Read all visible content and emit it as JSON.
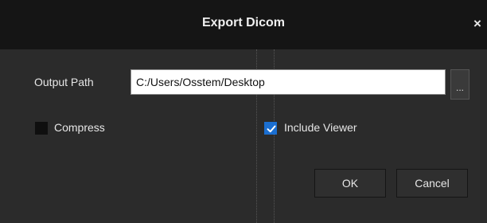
{
  "dialog": {
    "title": "Export Dicom",
    "close_label": "×"
  },
  "output": {
    "label": "Output Path",
    "value": "C:/Users/Osstem/Desktop",
    "browse_label": "..."
  },
  "options": {
    "compress_label": "Compress",
    "compress_checked": false,
    "include_viewer_label": "Include Viewer",
    "include_viewer_checked": true
  },
  "buttons": {
    "ok_label": "OK",
    "cancel_label": "Cancel"
  },
  "colors": {
    "titlebar": "#151515",
    "background": "#2b2b2b",
    "accent": "#1b6fd1"
  }
}
